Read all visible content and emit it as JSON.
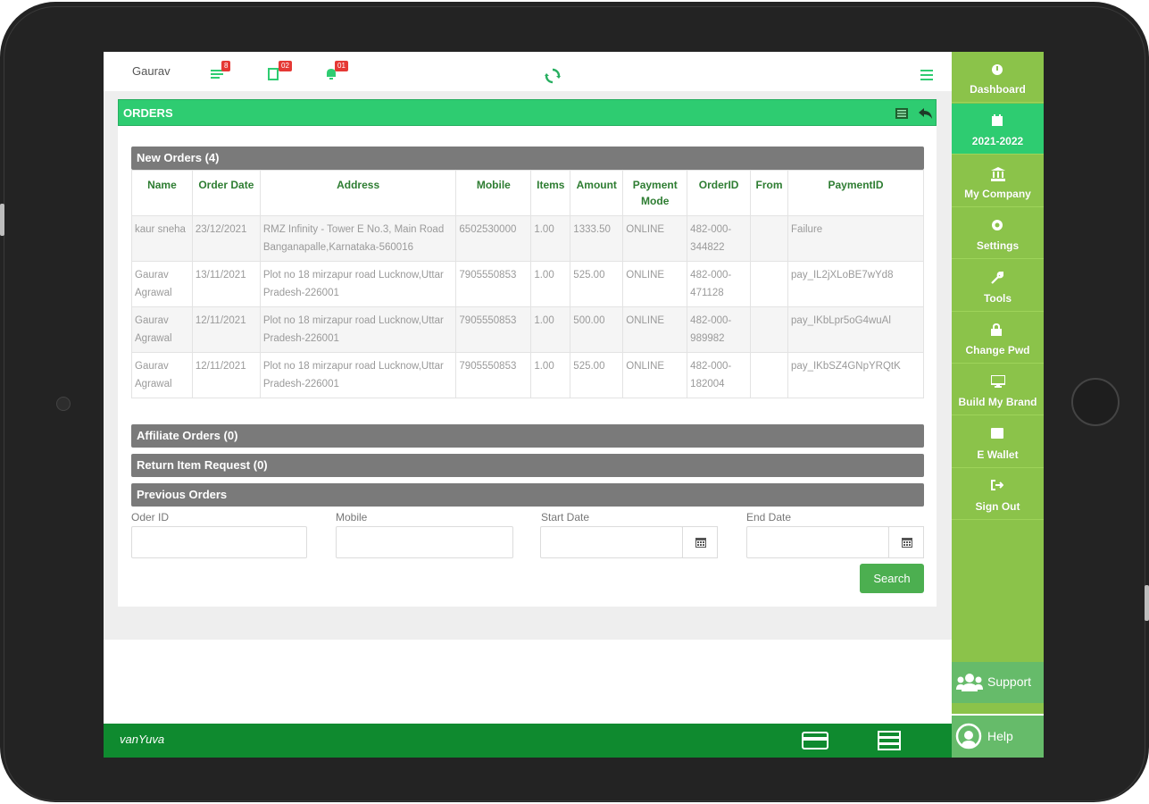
{
  "user": {
    "name": "Gaurav"
  },
  "top_badges": {
    "orders": "8",
    "reports": "02",
    "notifications": "01"
  },
  "orders": {
    "title": "ORDERS"
  },
  "new_orders": {
    "title": "New Orders (4)",
    "columns": [
      "Name",
      "Order Date",
      "Address",
      "Mobile",
      "Items",
      "Amount",
      "Payment Mode",
      "OrderID",
      "From",
      "PaymentID"
    ],
    "rows": [
      {
        "name": "kaur sneha",
        "date": "23/12/2021",
        "address": "RMZ Infinity - Tower E No.3, Main Road Banganapalle,Karnataka-560016",
        "mobile": "6502530000",
        "items": "1.00",
        "amount": "1333.50",
        "mode": "ONLINE",
        "order_id": "482-000-344822",
        "from": "",
        "payment_id": "Failure"
      },
      {
        "name": "Gaurav Agrawal",
        "date": "13/11/2021",
        "address": "Plot no 18 mirzapur road Lucknow,Uttar Pradesh-226001",
        "mobile": "7905550853",
        "items": "1.00",
        "amount": "525.00",
        "mode": "ONLINE",
        "order_id": "482-000-471128",
        "from": "",
        "payment_id": "pay_IL2jXLoBE7wYd8"
      },
      {
        "name": "Gaurav Agrawal",
        "date": "12/11/2021",
        "address": "Plot no 18 mirzapur road Lucknow,Uttar Pradesh-226001",
        "mobile": "7905550853",
        "items": "1.00",
        "amount": "500.00",
        "mode": "ONLINE",
        "order_id": "482-000-989982",
        "from": "",
        "payment_id": "pay_IKbLpr5oG4wuAl"
      },
      {
        "name": "Gaurav Agrawal",
        "date": "12/11/2021",
        "address": "Plot no 18 mirzapur road Lucknow,Uttar Pradesh-226001",
        "mobile": "7905550853",
        "items": "1.00",
        "amount": "525.00",
        "mode": "ONLINE",
        "order_id": "482-000-182004",
        "from": "",
        "payment_id": "pay_IKbSZ4GNpYRQtK"
      }
    ]
  },
  "affiliate_orders": {
    "title": "Affiliate Orders (0)"
  },
  "return_requests": {
    "title": "Return Item Request (0)"
  },
  "previous_orders": {
    "title": "Previous Orders",
    "order_id_label": "Oder ID",
    "mobile_label": "Mobile",
    "start_date_label": "Start Date",
    "end_date_label": "End Date",
    "search_label": "Search"
  },
  "sidebar": {
    "items": [
      {
        "label": "Dashboard",
        "icon": "dashboard-icon"
      },
      {
        "label": "2021-2022",
        "icon": "calendar-icon"
      },
      {
        "label": "My Company",
        "icon": "bank-icon"
      },
      {
        "label": "Settings",
        "icon": "gear-icon"
      },
      {
        "label": "Tools",
        "icon": "wrench-icon"
      },
      {
        "label": "Change Pwd",
        "icon": "lock-icon"
      },
      {
        "label": "Build My Brand",
        "icon": "monitor-icon"
      },
      {
        "label": "E Wallet",
        "icon": "wallet-icon"
      },
      {
        "label": "Sign Out",
        "icon": "sign-out-icon"
      }
    ],
    "support_label": "Support",
    "help_label": "Help"
  },
  "footer": {
    "brand": "vanYuva"
  },
  "colors": {
    "accent_green": "#2ecc71",
    "sidebar_green": "#8bc34a",
    "footer_green": "#0f8a2f",
    "section_gray": "#7a7a7a",
    "header_text_green": "#2e7d32"
  }
}
